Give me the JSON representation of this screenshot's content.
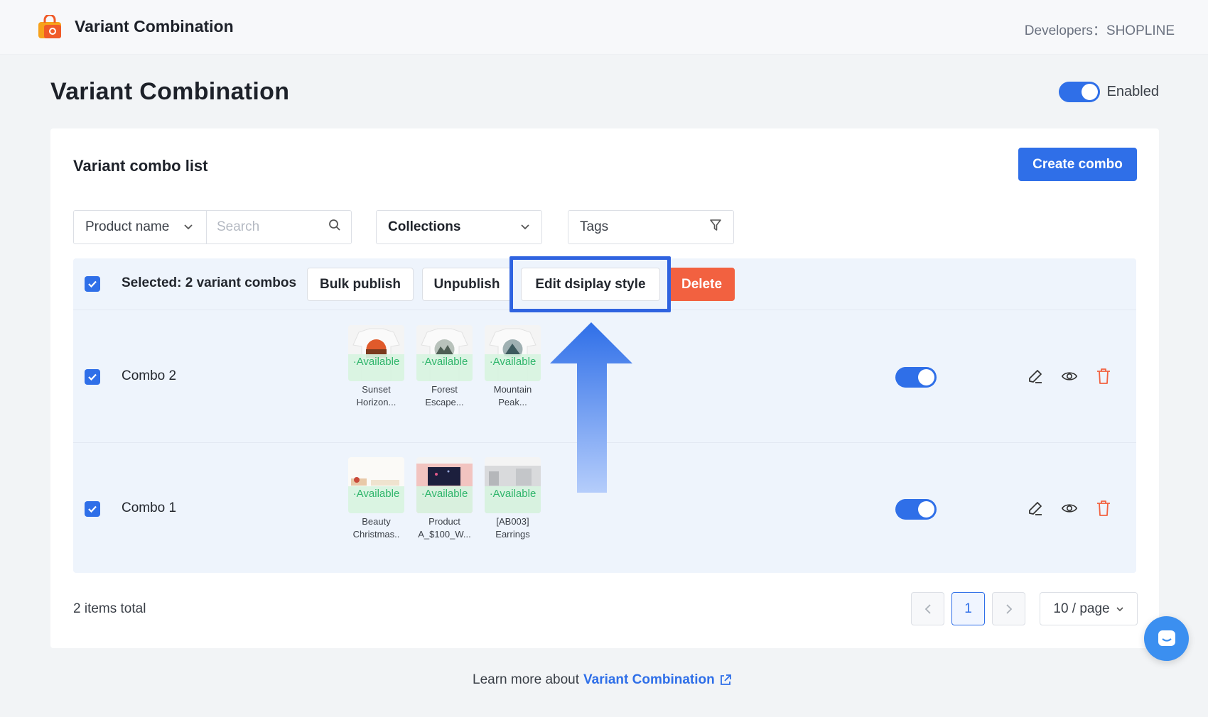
{
  "header": {
    "app_title": "Variant Combination",
    "developer": "Developers：SHOPLINE",
    "logo_icon": "shopping-bag-icon"
  },
  "page": {
    "title": "Variant Combination",
    "enabled_label": "Enabled",
    "enabled": true
  },
  "card": {
    "title": "Variant combo list",
    "create_label": "Create combo"
  },
  "filters": {
    "product_name_label": "Product name",
    "search_placeholder": "Search",
    "collections_label": "Collections",
    "tags_label": "Tags"
  },
  "toolbar": {
    "selected_label": "Selected: 2 variant combos",
    "bulk_publish": "Bulk publish",
    "unpublish": "Unpublish",
    "edit_display_style": "Edit dsiplay style",
    "delete": "Delete"
  },
  "rows": [
    {
      "name": "Combo 2",
      "checked": true,
      "enabled": true,
      "products": [
        {
          "status": "·Available",
          "name": "Sunset Horizon..."
        },
        {
          "status": "·Available",
          "name": "Forest Escape..."
        },
        {
          "status": "·Available",
          "name": "Mountain Peak..."
        }
      ]
    },
    {
      "name": "Combo 1",
      "checked": true,
      "enabled": true,
      "products": [
        {
          "status": "·Available",
          "name": "Beauty Christmas.."
        },
        {
          "status": "·Available",
          "name": "Product A_$100_W..."
        },
        {
          "status": "·Available",
          "name": "[AB003] Earrings"
        }
      ]
    }
  ],
  "footer": {
    "total": "2 items total",
    "current_page": "1",
    "page_size": "10 / page"
  },
  "learn_more": {
    "prefix": "Learn more about",
    "link": "Variant Combination"
  },
  "colors": {
    "primary": "#2f6fe8",
    "danger": "#f26140",
    "available": "#2fb56b"
  }
}
